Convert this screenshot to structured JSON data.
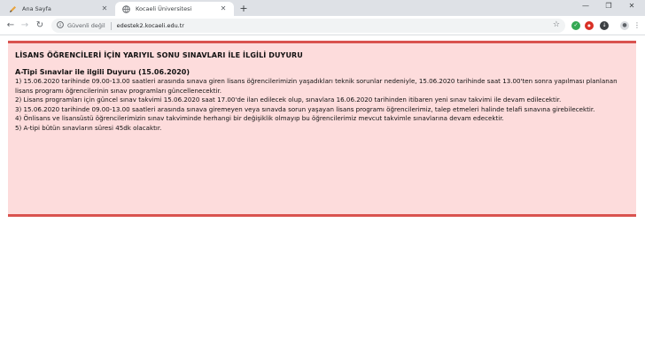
{
  "browser": {
    "tabs": [
      {
        "title": "Ana Sayfa",
        "active": false,
        "icon": "pencil-icon"
      },
      {
        "title": "Kocaeli Üniversitesi",
        "active": true,
        "icon": "globe-icon"
      }
    ],
    "address": {
      "security_label": "Güvenli değil",
      "url": "edestek2.kocaeli.edu.tr"
    }
  },
  "notice": {
    "title": "LİSANS ÖĞRENCİLERİ İÇİN YARIYIL SONU SINAVLARI İLE İLGİLİ DUYURU",
    "subtitle": "A-Tipi Sınavlar ile ilgili Duyuru (15.06.2020)",
    "items": [
      "1) 15.06.2020 tarihinde 09.00-13.00 saatleri arasında sınava giren lisans öğrencilerimizin yaşadıkları teknik sorunlar nedeniyle, 15.06.2020 tarihinde saat 13.00'ten sonra yapılması planlanan lisans programı öğrencilerinin sınav programları güncellenecektir.",
      "2) Lisans programları için güncel sınav takvimi 15.06.2020 saat 17.00'de ilan edilecek olup, sınavlara 16.06.2020 tarihinden itibaren yeni sınav takvimi ile devam edilecektir.",
      "3) 15.06.2020 tarihinde 09.00-13.00 saatleri arasında sınava giremeyen veya sınavda sorun yaşayan lisans programı öğrencilerimiz, talep etmeleri halinde telafi sınavına girebilecektir.",
      "4) Önlisans ve lisansüstü öğrencilerimizin sınav takviminde herhangi bir değişiklik olmayıp bu öğrencilerimiz mevcut takvimle sınavlarına devam edecektir.",
      "5) A-tipi bütün sınavların süresi 45dk olacaktır."
    ]
  },
  "colors": {
    "notice_background": "#fddcdc",
    "notice_border": "#d9534f"
  }
}
